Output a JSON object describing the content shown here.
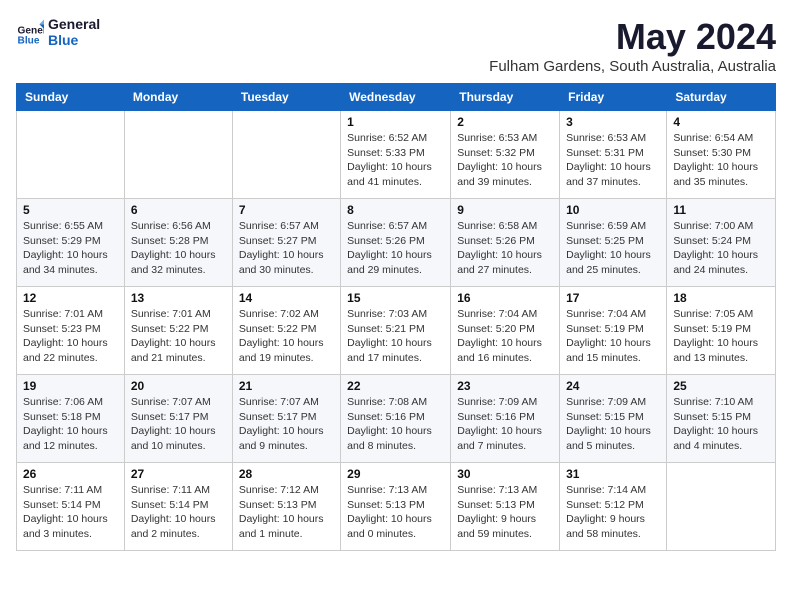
{
  "header": {
    "logo_general": "General",
    "logo_blue": "Blue",
    "month_title": "May 2024",
    "location": "Fulham Gardens, South Australia, Australia"
  },
  "days_of_week": [
    "Sunday",
    "Monday",
    "Tuesday",
    "Wednesday",
    "Thursday",
    "Friday",
    "Saturday"
  ],
  "weeks": [
    [
      {
        "day": "",
        "info": ""
      },
      {
        "day": "",
        "info": ""
      },
      {
        "day": "",
        "info": ""
      },
      {
        "day": "1",
        "info": "Sunrise: 6:52 AM\nSunset: 5:33 PM\nDaylight: 10 hours\nand 41 minutes."
      },
      {
        "day": "2",
        "info": "Sunrise: 6:53 AM\nSunset: 5:32 PM\nDaylight: 10 hours\nand 39 minutes."
      },
      {
        "day": "3",
        "info": "Sunrise: 6:53 AM\nSunset: 5:31 PM\nDaylight: 10 hours\nand 37 minutes."
      },
      {
        "day": "4",
        "info": "Sunrise: 6:54 AM\nSunset: 5:30 PM\nDaylight: 10 hours\nand 35 minutes."
      }
    ],
    [
      {
        "day": "5",
        "info": "Sunrise: 6:55 AM\nSunset: 5:29 PM\nDaylight: 10 hours\nand 34 minutes."
      },
      {
        "day": "6",
        "info": "Sunrise: 6:56 AM\nSunset: 5:28 PM\nDaylight: 10 hours\nand 32 minutes."
      },
      {
        "day": "7",
        "info": "Sunrise: 6:57 AM\nSunset: 5:27 PM\nDaylight: 10 hours\nand 30 minutes."
      },
      {
        "day": "8",
        "info": "Sunrise: 6:57 AM\nSunset: 5:26 PM\nDaylight: 10 hours\nand 29 minutes."
      },
      {
        "day": "9",
        "info": "Sunrise: 6:58 AM\nSunset: 5:26 PM\nDaylight: 10 hours\nand 27 minutes."
      },
      {
        "day": "10",
        "info": "Sunrise: 6:59 AM\nSunset: 5:25 PM\nDaylight: 10 hours\nand 25 minutes."
      },
      {
        "day": "11",
        "info": "Sunrise: 7:00 AM\nSunset: 5:24 PM\nDaylight: 10 hours\nand 24 minutes."
      }
    ],
    [
      {
        "day": "12",
        "info": "Sunrise: 7:01 AM\nSunset: 5:23 PM\nDaylight: 10 hours\nand 22 minutes."
      },
      {
        "day": "13",
        "info": "Sunrise: 7:01 AM\nSunset: 5:22 PM\nDaylight: 10 hours\nand 21 minutes."
      },
      {
        "day": "14",
        "info": "Sunrise: 7:02 AM\nSunset: 5:22 PM\nDaylight: 10 hours\nand 19 minutes."
      },
      {
        "day": "15",
        "info": "Sunrise: 7:03 AM\nSunset: 5:21 PM\nDaylight: 10 hours\nand 17 minutes."
      },
      {
        "day": "16",
        "info": "Sunrise: 7:04 AM\nSunset: 5:20 PM\nDaylight: 10 hours\nand 16 minutes."
      },
      {
        "day": "17",
        "info": "Sunrise: 7:04 AM\nSunset: 5:19 PM\nDaylight: 10 hours\nand 15 minutes."
      },
      {
        "day": "18",
        "info": "Sunrise: 7:05 AM\nSunset: 5:19 PM\nDaylight: 10 hours\nand 13 minutes."
      }
    ],
    [
      {
        "day": "19",
        "info": "Sunrise: 7:06 AM\nSunset: 5:18 PM\nDaylight: 10 hours\nand 12 minutes."
      },
      {
        "day": "20",
        "info": "Sunrise: 7:07 AM\nSunset: 5:17 PM\nDaylight: 10 hours\nand 10 minutes."
      },
      {
        "day": "21",
        "info": "Sunrise: 7:07 AM\nSunset: 5:17 PM\nDaylight: 10 hours\nand 9 minutes."
      },
      {
        "day": "22",
        "info": "Sunrise: 7:08 AM\nSunset: 5:16 PM\nDaylight: 10 hours\nand 8 minutes."
      },
      {
        "day": "23",
        "info": "Sunrise: 7:09 AM\nSunset: 5:16 PM\nDaylight: 10 hours\nand 7 minutes."
      },
      {
        "day": "24",
        "info": "Sunrise: 7:09 AM\nSunset: 5:15 PM\nDaylight: 10 hours\nand 5 minutes."
      },
      {
        "day": "25",
        "info": "Sunrise: 7:10 AM\nSunset: 5:15 PM\nDaylight: 10 hours\nand 4 minutes."
      }
    ],
    [
      {
        "day": "26",
        "info": "Sunrise: 7:11 AM\nSunset: 5:14 PM\nDaylight: 10 hours\nand 3 minutes."
      },
      {
        "day": "27",
        "info": "Sunrise: 7:11 AM\nSunset: 5:14 PM\nDaylight: 10 hours\nand 2 minutes."
      },
      {
        "day": "28",
        "info": "Sunrise: 7:12 AM\nSunset: 5:13 PM\nDaylight: 10 hours\nand 1 minute."
      },
      {
        "day": "29",
        "info": "Sunrise: 7:13 AM\nSunset: 5:13 PM\nDaylight: 10 hours\nand 0 minutes."
      },
      {
        "day": "30",
        "info": "Sunrise: 7:13 AM\nSunset: 5:13 PM\nDaylight: 9 hours\nand 59 minutes."
      },
      {
        "day": "31",
        "info": "Sunrise: 7:14 AM\nSunset: 5:12 PM\nDaylight: 9 hours\nand 58 minutes."
      },
      {
        "day": "",
        "info": ""
      }
    ]
  ]
}
